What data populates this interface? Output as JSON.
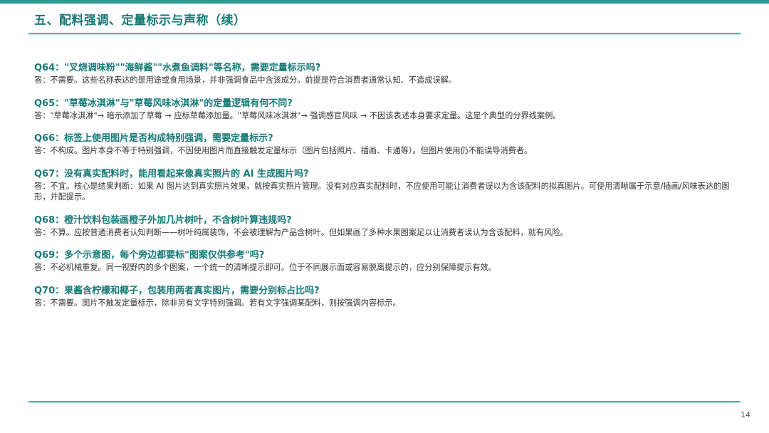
{
  "title": "五、配料强调、定量标示与声称（续）",
  "page_number": "14",
  "items": [
    {
      "question": "Q64：\"叉烧调味粉\"\"海鲜酱\"\"水煮鱼调料\"等名称，需要定量标示吗?",
      "answer": "答：不需要。这些名称表达的是用途或食用场景，并非强调食品中含该成分。前提是符合消费者通常认知、不造成误解。"
    },
    {
      "question": "Q65：\"草莓冰淇淋\"与\"草莓风味冰淇淋\"的定量逻辑有何不同?",
      "answer": "答：\"草莓冰淇淋\"→ 暗示添加了草莓 → 应标草莓添加量。\"草莓风味冰淇淋\"→ 强调感官风味 → 不因该表述本身要求定量。这是个典型的分界线案例。"
    },
    {
      "question": "Q66：标签上使用图片是否构成特别强调，需要定量标示?",
      "answer": "答：不构成。图片本身不等于特别强调，不因使用图片而直接触发定量标示（图片包括照片、插画、卡通等）。但图片使用仍不能误导消费者。"
    },
    {
      "question": "Q67：没有真实配料时，能用看起来像真实照片的 AI 生成图片吗?",
      "answer": "答：不宜。核心是结果判断：如果 AI 图片达到真实照片效果，就按真实照片管理。没有对应真实配料时，不应使用可能让消费者误以为含该配料的拟真图片。可使用清晰属于示意/插画/风味表达的图形，并配提示。"
    },
    {
      "question": "Q68：橙汁饮料包装画橙子外加几片树叶，不含树叶算违规吗?",
      "answer": "答：不算。应按普通消费者认知判断——树叶纯属装饰，不会被理解为产品含树叶。但如果画了多种水果图案足以让消费者误认为含该配料，就有风险。"
    },
    {
      "question": "Q69：多个示意图，每个旁边都要标\"图案仅供参考\"吗?",
      "answer": "答：不必机械重复。同一视野内的多个图案，一个统一的清晰提示即可。位于不同展示面或容易脱离提示的，应分别保障提示有效。"
    },
    {
      "question": "Q70：果酱含柠檬和椰子，包装用两者真实图片，需要分别标占比吗?",
      "answer": "答：不需要。图片不触发定量标示，除非另有文字特别强调。若有文字强调某配料，则按强调内容标示。"
    }
  ]
}
